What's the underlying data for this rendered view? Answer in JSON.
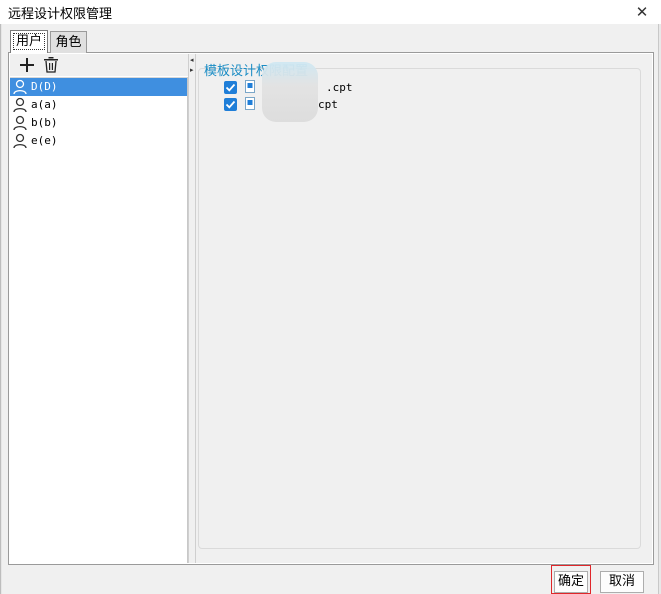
{
  "window": {
    "title": "远程设计权限管理",
    "close_symbol": "✕"
  },
  "tabs": [
    {
      "label": "用户",
      "selected": true
    },
    {
      "label": "角色",
      "selected": false
    }
  ],
  "toolbar": {
    "add_icon": "plus-icon",
    "delete_icon": "trash-icon"
  },
  "users": [
    {
      "name": "D(D)",
      "selected": true
    },
    {
      "name": "a(a)",
      "selected": false
    },
    {
      "name": "b(b)",
      "selected": false
    },
    {
      "name": "e(e)",
      "selected": false
    }
  ],
  "splitter": {
    "left_arrow": "◂",
    "right_arrow": "▸"
  },
  "config": {
    "title": "模板设计权限配置",
    "files": [
      {
        "name": ".cpt",
        "checked": true
      },
      {
        "name": "cpt",
        "checked": true
      }
    ]
  },
  "buttons": {
    "ok": "确定",
    "cancel": "取消"
  },
  "colors": {
    "accent": "#1a8cc4",
    "selection": "#3f8fe0",
    "checkbox": "#1f7ed8",
    "highlight_border": "#e0262a"
  }
}
